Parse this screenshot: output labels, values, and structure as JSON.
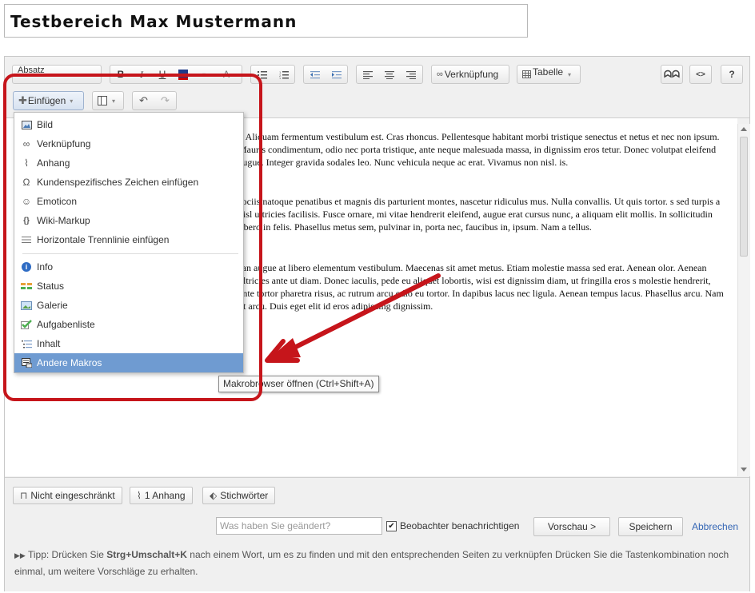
{
  "page": {
    "title": "Testbereich Max Mustermann"
  },
  "toolbar": {
    "paragraph_select": "Absatz",
    "link_label": "Verknüpfung",
    "table_label": "Tabelle",
    "insert_label": "Einfügen",
    "source_label": "<>",
    "help_label": "?"
  },
  "editor": {
    "paragraphs": [
      "t. Aliquam fermentum vestibulum est. Cras rhoncus. Pellentesque habitant morbi tristique senectus et netus et nec non ipsum. Mauris condimentum, odio nec porta tristique, ante neque malesuada massa, in dignissim eros tetur. Donec volutpat eleifend augue. Integer gravida sodales leo. Nunc vehicula neque ac erat. Vivamus non nisl. is.",
      "sociis natoque penatibus et magnis dis parturient montes, nascetur ridiculus mus. Nulla convallis. Ut quis tortor. s sed turpis a nisl ultricies facilisis. Fusce ornare, mi vitae hendrerit eleifend, augue erat cursus nunc, a aliquam elit mollis. In sollicitudin libero in felis. Phasellus metus sem, pulvinar in, porta nec, faucibus in, ipsum. Nam a tellus.",
      "san augue at libero elementum vestibulum. Maecenas sit amet metus. Etiam molestie massa sed erat. Aenean olor. Aenean ultricies ante ut diam. Donec iaculis, pede eu aliquet lobortis, wisi est dignissim diam, ut fringilla eros s molestie hendrerit, ante tortor pharetra risus, ac rutrum arcu odio eu tortor. In dapibus lacus nec ligula. Aenean tempus lacus. Phasellus arcu. Nam ut arcu. Duis eget elit id eros adipiscing dignissim."
    ]
  },
  "insert_menu": {
    "items": [
      {
        "label": "Bild",
        "icon": "image-icon"
      },
      {
        "label": "Verknüpfung",
        "icon": "link-icon"
      },
      {
        "label": "Anhang",
        "icon": "paperclip-icon"
      },
      {
        "label": "Kundenspezifisches Zeichen einfügen",
        "icon": "omega-icon"
      },
      {
        "label": "Emoticon",
        "icon": "smiley-icon"
      },
      {
        "label": "Wiki-Markup",
        "icon": "braces-icon"
      },
      {
        "label": "Horizontale Trennlinie einfügen",
        "icon": "horizontal-rule-icon"
      },
      {
        "label": "Info",
        "icon": "info-icon"
      },
      {
        "label": "Status",
        "icon": "status-icon"
      },
      {
        "label": "Galerie",
        "icon": "gallery-icon"
      },
      {
        "label": "Aufgabenliste",
        "icon": "checkmark-icon"
      },
      {
        "label": "Inhalt",
        "icon": "toc-icon"
      },
      {
        "label": "Andere Makros",
        "icon": "macro-icon",
        "selected": true
      }
    ]
  },
  "tooltip": {
    "text": "Makrobrowser öffnen (Ctrl+Shift+A)"
  },
  "footer": {
    "restrictions_label": "Nicht eingeschränkt",
    "attachments_label": "1 Anhang",
    "labels_label": "Stichwörter",
    "change_placeholder": "Was haben Sie geändert?",
    "notify_label": "Beobachter benachrichtigen",
    "notify_checked": true,
    "preview_label": "Vorschau >",
    "save_label": "Speichern",
    "cancel_label": "Abbrechen",
    "tip_prefix": "Tipp: Drücken Sie ",
    "tip_shortcut1": "Strg+Umschalt+K",
    "tip_middle": " nach einem Wort, um es zu finden und mit den entsprechenden Seiten zu verknüpfen Drücken Sie die Tastenkombination noch einmal, um weitere Vorschläge zu erhalten."
  },
  "colors": {
    "accent": "#6f9bd1",
    "callout": "#c6151b",
    "link": "#3466b5"
  }
}
